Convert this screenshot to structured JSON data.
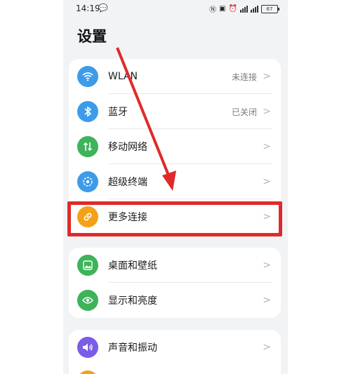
{
  "status": {
    "time": "14:19",
    "battery": "67"
  },
  "page_title": "设置",
  "groups": [
    {
      "items": [
        {
          "label": "WLAN",
          "value": "未连接",
          "icon": "wifi-icon",
          "color": "#3d9be9"
        },
        {
          "label": "蓝牙",
          "value": "已关闭",
          "icon": "bluetooth-icon",
          "color": "#3d9be9"
        },
        {
          "label": "移动网络",
          "value": "",
          "icon": "mobile-data-icon",
          "color": "#3db35a"
        },
        {
          "label": "超级终端",
          "value": "",
          "icon": "super-device-icon",
          "color": "#3d9be9"
        },
        {
          "label": "更多连接",
          "value": "",
          "icon": "link-icon",
          "color": "#f5a019"
        }
      ]
    },
    {
      "items": [
        {
          "label": "桌面和壁纸",
          "value": "",
          "icon": "wallpaper-icon",
          "color": "#3db35a"
        },
        {
          "label": "显示和亮度",
          "value": "",
          "icon": "eye-icon",
          "color": "#3db35a"
        }
      ]
    },
    {
      "items": [
        {
          "label": "声音和振动",
          "value": "",
          "icon": "sound-icon",
          "color": "#7b5ce6"
        }
      ]
    }
  ],
  "colors": {
    "highlight": "#e02a2a"
  }
}
